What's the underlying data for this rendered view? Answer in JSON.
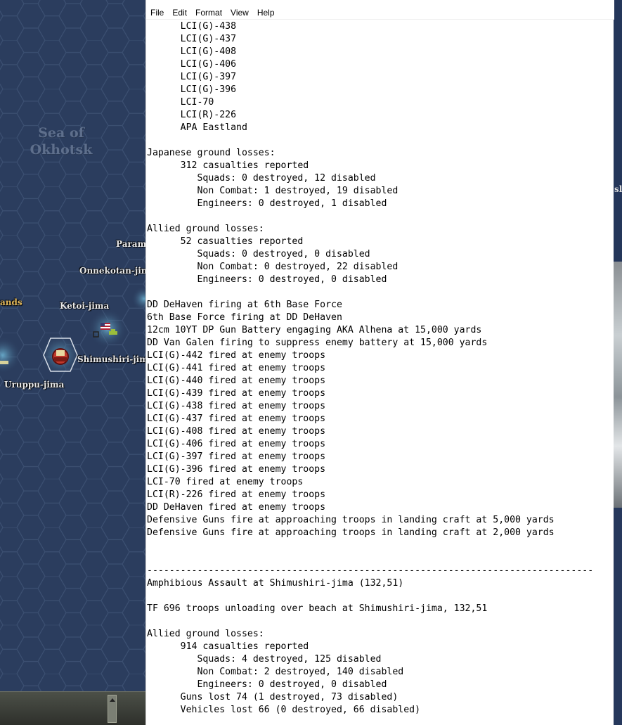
{
  "window": {
    "menu": [
      "File",
      "Edit",
      "Format",
      "View",
      "Help"
    ]
  },
  "map": {
    "sea_label": "Sea of\nOkhotsk",
    "labels": {
      "paramushiro": "Paramu",
      "onnekotan": "Onnekotan-jima",
      "islands": "ands",
      "ketoi": "Ketoi-jima",
      "shimushiri": "Shimushiri-jima",
      "uruppu": "Uruppu-jima",
      "right_partial": "sl"
    },
    "colors": {
      "sea": "#2b3d5e",
      "hex_line": "#3c5072",
      "coast_glow": "#5fa4c8"
    },
    "markers": {
      "us_flag": "us-flag-icon",
      "japan_base": "japanese-base-icon"
    }
  },
  "document": {
    "lines": [
      "      LCI(G)-438",
      "      LCI(G)-437",
      "      LCI(G)-408",
      "      LCI(G)-406",
      "      LCI(G)-397",
      "      LCI(G)-396",
      "      LCI-70",
      "      LCI(R)-226",
      "      APA Eastland",
      "",
      "Japanese ground losses:",
      "      312 casualties reported",
      "         Squads: 0 destroyed, 12 disabled",
      "         Non Combat: 1 destroyed, 19 disabled",
      "         Engineers: 0 destroyed, 1 disabled",
      "",
      "Allied ground losses:",
      "      52 casualties reported",
      "         Squads: 0 destroyed, 0 disabled",
      "         Non Combat: 0 destroyed, 22 disabled",
      "         Engineers: 0 destroyed, 0 disabled",
      "",
      "DD DeHaven firing at 6th Base Force",
      "6th Base Force firing at DD DeHaven",
      "12cm 10YT DP Gun Battery engaging AKA Alhena at 15,000 yards",
      "DD Van Galen firing to suppress enemy battery at 15,000 yards",
      "LCI(G)-442 fired at enemy troops",
      "LCI(G)-441 fired at enemy troops",
      "LCI(G)-440 fired at enemy troops",
      "LCI(G)-439 fired at enemy troops",
      "LCI(G)-438 fired at enemy troops",
      "LCI(G)-437 fired at enemy troops",
      "LCI(G)-408 fired at enemy troops",
      "LCI(G)-406 fired at enemy troops",
      "LCI(G)-397 fired at enemy troops",
      "LCI(G)-396 fired at enemy troops",
      "LCI-70 fired at enemy troops",
      "LCI(R)-226 fired at enemy troops",
      "DD DeHaven fired at enemy troops",
      "Defensive Guns fire at approaching troops in landing craft at 5,000 yards",
      "Defensive Guns fire at approaching troops in landing craft at 2,000 yards",
      "",
      "",
      "--------------------------------------------------------------------------------",
      "Amphibious Assault at Shimushiri-jima (132,51)",
      "",
      "TF 696 troops unloading over beach at Shimushiri-jima, 132,51",
      "",
      "Allied ground losses:",
      "      914 casualties reported",
      "         Squads: 4 destroyed, 125 disabled",
      "         Non Combat: 2 destroyed, 140 disabled",
      "         Engineers: 0 destroyed, 0 disabled",
      "      Guns lost 74 (1 destroyed, 73 disabled)",
      "      Vehicles lost 66 (0 destroyed, 66 disabled)"
    ]
  }
}
